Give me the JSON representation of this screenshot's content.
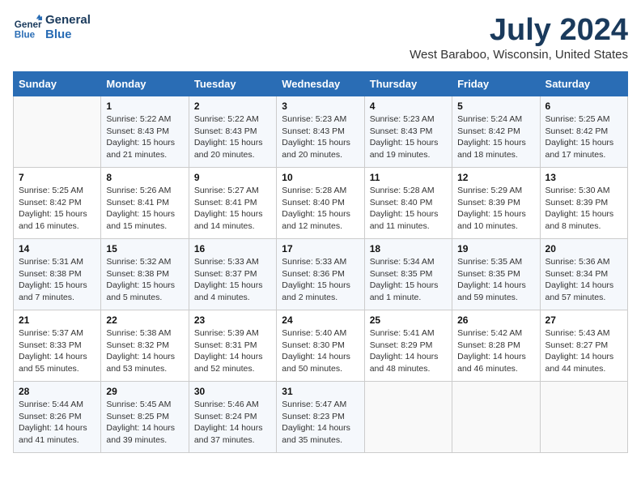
{
  "logo": {
    "line1": "General",
    "line2": "Blue"
  },
  "title": "July 2024",
  "subtitle": "West Baraboo, Wisconsin, United States",
  "weekdays": [
    "Sunday",
    "Monday",
    "Tuesday",
    "Wednesday",
    "Thursday",
    "Friday",
    "Saturday"
  ],
  "weeks": [
    [
      {
        "day": "",
        "info": ""
      },
      {
        "day": "1",
        "info": "Sunrise: 5:22 AM\nSunset: 8:43 PM\nDaylight: 15 hours\nand 21 minutes."
      },
      {
        "day": "2",
        "info": "Sunrise: 5:22 AM\nSunset: 8:43 PM\nDaylight: 15 hours\nand 20 minutes."
      },
      {
        "day": "3",
        "info": "Sunrise: 5:23 AM\nSunset: 8:43 PM\nDaylight: 15 hours\nand 20 minutes."
      },
      {
        "day": "4",
        "info": "Sunrise: 5:23 AM\nSunset: 8:43 PM\nDaylight: 15 hours\nand 19 minutes."
      },
      {
        "day": "5",
        "info": "Sunrise: 5:24 AM\nSunset: 8:42 PM\nDaylight: 15 hours\nand 18 minutes."
      },
      {
        "day": "6",
        "info": "Sunrise: 5:25 AM\nSunset: 8:42 PM\nDaylight: 15 hours\nand 17 minutes."
      }
    ],
    [
      {
        "day": "7",
        "info": "Sunrise: 5:25 AM\nSunset: 8:42 PM\nDaylight: 15 hours\nand 16 minutes."
      },
      {
        "day": "8",
        "info": "Sunrise: 5:26 AM\nSunset: 8:41 PM\nDaylight: 15 hours\nand 15 minutes."
      },
      {
        "day": "9",
        "info": "Sunrise: 5:27 AM\nSunset: 8:41 PM\nDaylight: 15 hours\nand 14 minutes."
      },
      {
        "day": "10",
        "info": "Sunrise: 5:28 AM\nSunset: 8:40 PM\nDaylight: 15 hours\nand 12 minutes."
      },
      {
        "day": "11",
        "info": "Sunrise: 5:28 AM\nSunset: 8:40 PM\nDaylight: 15 hours\nand 11 minutes."
      },
      {
        "day": "12",
        "info": "Sunrise: 5:29 AM\nSunset: 8:39 PM\nDaylight: 15 hours\nand 10 minutes."
      },
      {
        "day": "13",
        "info": "Sunrise: 5:30 AM\nSunset: 8:39 PM\nDaylight: 15 hours\nand 8 minutes."
      }
    ],
    [
      {
        "day": "14",
        "info": "Sunrise: 5:31 AM\nSunset: 8:38 PM\nDaylight: 15 hours\nand 7 minutes."
      },
      {
        "day": "15",
        "info": "Sunrise: 5:32 AM\nSunset: 8:38 PM\nDaylight: 15 hours\nand 5 minutes."
      },
      {
        "day": "16",
        "info": "Sunrise: 5:33 AM\nSunset: 8:37 PM\nDaylight: 15 hours\nand 4 minutes."
      },
      {
        "day": "17",
        "info": "Sunrise: 5:33 AM\nSunset: 8:36 PM\nDaylight: 15 hours\nand 2 minutes."
      },
      {
        "day": "18",
        "info": "Sunrise: 5:34 AM\nSunset: 8:35 PM\nDaylight: 15 hours\nand 1 minute."
      },
      {
        "day": "19",
        "info": "Sunrise: 5:35 AM\nSunset: 8:35 PM\nDaylight: 14 hours\nand 59 minutes."
      },
      {
        "day": "20",
        "info": "Sunrise: 5:36 AM\nSunset: 8:34 PM\nDaylight: 14 hours\nand 57 minutes."
      }
    ],
    [
      {
        "day": "21",
        "info": "Sunrise: 5:37 AM\nSunset: 8:33 PM\nDaylight: 14 hours\nand 55 minutes."
      },
      {
        "day": "22",
        "info": "Sunrise: 5:38 AM\nSunset: 8:32 PM\nDaylight: 14 hours\nand 53 minutes."
      },
      {
        "day": "23",
        "info": "Sunrise: 5:39 AM\nSunset: 8:31 PM\nDaylight: 14 hours\nand 52 minutes."
      },
      {
        "day": "24",
        "info": "Sunrise: 5:40 AM\nSunset: 8:30 PM\nDaylight: 14 hours\nand 50 minutes."
      },
      {
        "day": "25",
        "info": "Sunrise: 5:41 AM\nSunset: 8:29 PM\nDaylight: 14 hours\nand 48 minutes."
      },
      {
        "day": "26",
        "info": "Sunrise: 5:42 AM\nSunset: 8:28 PM\nDaylight: 14 hours\nand 46 minutes."
      },
      {
        "day": "27",
        "info": "Sunrise: 5:43 AM\nSunset: 8:27 PM\nDaylight: 14 hours\nand 44 minutes."
      }
    ],
    [
      {
        "day": "28",
        "info": "Sunrise: 5:44 AM\nSunset: 8:26 PM\nDaylight: 14 hours\nand 41 minutes."
      },
      {
        "day": "29",
        "info": "Sunrise: 5:45 AM\nSunset: 8:25 PM\nDaylight: 14 hours\nand 39 minutes."
      },
      {
        "day": "30",
        "info": "Sunrise: 5:46 AM\nSunset: 8:24 PM\nDaylight: 14 hours\nand 37 minutes."
      },
      {
        "day": "31",
        "info": "Sunrise: 5:47 AM\nSunset: 8:23 PM\nDaylight: 14 hours\nand 35 minutes."
      },
      {
        "day": "",
        "info": ""
      },
      {
        "day": "",
        "info": ""
      },
      {
        "day": "",
        "info": ""
      }
    ]
  ]
}
